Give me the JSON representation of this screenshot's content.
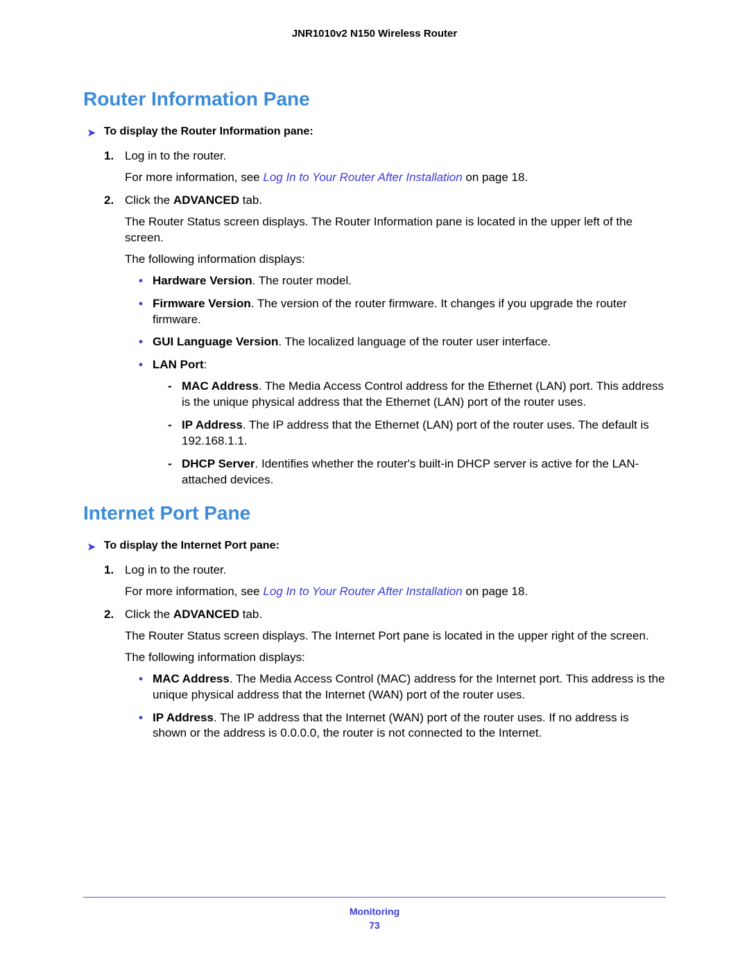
{
  "header": "JNR1010v2 N150 Wireless Router",
  "section1": {
    "title": "Router Information Pane",
    "task": "To display the Router Information pane:",
    "step1": "Log in to the router.",
    "step1_more_prefix": "For more information, see ",
    "step1_link": "Log In to Your Router After Installation",
    "step1_more_suffix": " on page 18.",
    "step2_prefix": "Click the ",
    "step2_bold": "ADVANCED",
    "step2_suffix": " tab.",
    "step2_desc": "The Router Status screen displays. The Router Information pane is located in the upper left of the screen.",
    "step2_info": "The following information displays:",
    "bullets": {
      "hw_label": "Hardware Version",
      "hw_text": ". The router model.",
      "fw_label": "Firmware Version",
      "fw_text": ". The version of the router firmware. It changes if you upgrade the router firmware.",
      "gui_label": "GUI Language Version",
      "gui_text": ". The localized language of the router user interface.",
      "lan_label": "LAN Port",
      "lan_colon": ":",
      "lan_mac_label": "MAC Address",
      "lan_mac_text": ". The Media Access Control address for the Ethernet (LAN) port. This address is the unique physical address that the Ethernet (LAN) port of the router uses.",
      "lan_ip_label": "IP Address",
      "lan_ip_text": ". The IP address that the Ethernet (LAN) port of the router uses. The default is 192.168.1.1.",
      "lan_dhcp_label": "DHCP Server",
      "lan_dhcp_text": ". Identifies whether the router's built-in DHCP server is active for the LAN-attached devices."
    }
  },
  "section2": {
    "title": "Internet Port Pane",
    "task": "To display the Internet Port pane:",
    "step1": "Log in to the router.",
    "step1_more_prefix": "For more information, see ",
    "step1_link": "Log In to Your Router After Installation",
    "step1_more_suffix": " on page 18.",
    "step2_prefix": "Click the ",
    "step2_bold": "ADVANCED",
    "step2_suffix": " tab.",
    "step2_desc": "The Router Status screen displays. The Internet Port pane is located in the upper right of the screen.",
    "step2_info": "The following information displays:",
    "bullets": {
      "mac_label": "MAC Address",
      "mac_text": ". The Media Access Control (MAC) address for the Internet port. This address is the unique physical address that the Internet (WAN) port of the router uses.",
      "ip_label": "IP Address",
      "ip_text": ". The IP address that the Internet (WAN) port of the router uses. If no address is shown or the address is 0.0.0.0, the router is not connected to the Internet."
    }
  },
  "footer": {
    "label": "Monitoring",
    "page": "73"
  }
}
